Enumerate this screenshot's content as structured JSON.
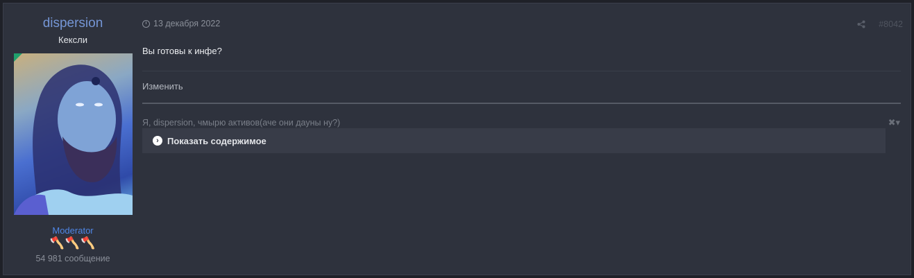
{
  "user": {
    "name": "dispersion",
    "title": "Кексли",
    "role": "Moderator",
    "badges": "🪓🪓🪓",
    "message_count": "54 981 сообщение"
  },
  "post": {
    "date": "13 декабря 2022",
    "number": "#8042",
    "body": "Вы готовы к инфе?",
    "edit_label": "Изменить",
    "signature": "Я, dispersion, чмырю активов(аче они дауны ну?)",
    "signature_controls": "✖▾",
    "spoiler_label": "Показать содержимое",
    "share_icon": "share-icon"
  },
  "colors": {
    "username": "#7596d6",
    "role": "#4f86e6",
    "badge": "#e0925a",
    "online_indicator": "#1fa06c",
    "background": "#2e323d"
  }
}
